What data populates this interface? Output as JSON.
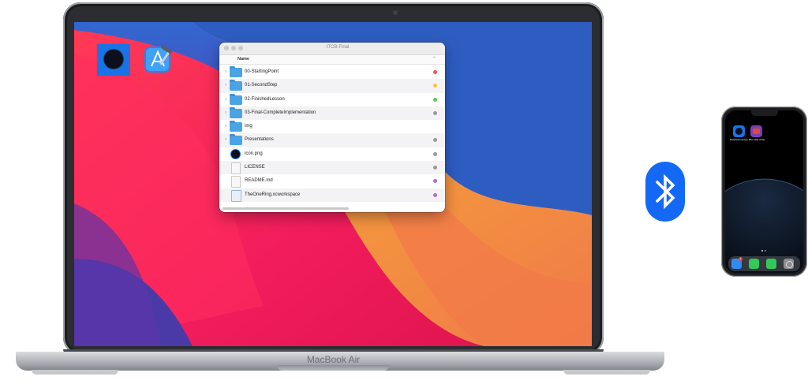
{
  "laptop": {
    "model_label": "MacBook Air"
  },
  "desktop": {
    "icons": [
      {
        "name": "app-icon"
      },
      {
        "name": "xcode-icon"
      }
    ]
  },
  "finder": {
    "title": "ITCB-Final",
    "column_header": "Name",
    "items": [
      {
        "name": "00-StartingPoint",
        "kind": "folder",
        "tag_color": "#f1574b"
      },
      {
        "name": "01-SecondStep",
        "kind": "folder",
        "tag_color": "#f6c342"
      },
      {
        "name": "02-FinishedLesson",
        "kind": "folder",
        "tag_color": "#5cc94f"
      },
      {
        "name": "03-Final-CompleteImplementation",
        "kind": "folder",
        "tag_color": "#9a9a9a"
      },
      {
        "name": "img",
        "kind": "folder",
        "tag_color": ""
      },
      {
        "name": "Presentations",
        "kind": "folder",
        "tag_color": "#9a9a9a"
      },
      {
        "name": "icon.png",
        "kind": "image",
        "tag_color": "#9a9a9a"
      },
      {
        "name": "LICENSE",
        "kind": "document",
        "tag_color": "#9a9a9a"
      },
      {
        "name": "README.md",
        "kind": "document",
        "tag_color": "#b469d6"
      },
      {
        "name": "TheOneRing.xcworkspace",
        "kind": "workspace",
        "tag_color": "#b469d6"
      }
    ]
  },
  "bluetooth": {
    "icon": "bluetooth-icon",
    "color": "#1469f4"
  },
  "phone": {
    "home_icons": [
      {
        "label": "MyAwesomeApp",
        "color": "#1874e6"
      },
      {
        "label": "Blue Hair Chief",
        "color": "#7a3fb5"
      }
    ],
    "dock_icons": [
      {
        "name": "mail-icon",
        "color": "#2f8cf3",
        "badge": "1"
      },
      {
        "name": "phone-icon",
        "color": "#34c759",
        "badge": ""
      },
      {
        "name": "messages-icon",
        "color": "#34c759",
        "badge": ""
      },
      {
        "name": "settings-icon",
        "color": "#8e8e93",
        "badge": ""
      }
    ]
  }
}
